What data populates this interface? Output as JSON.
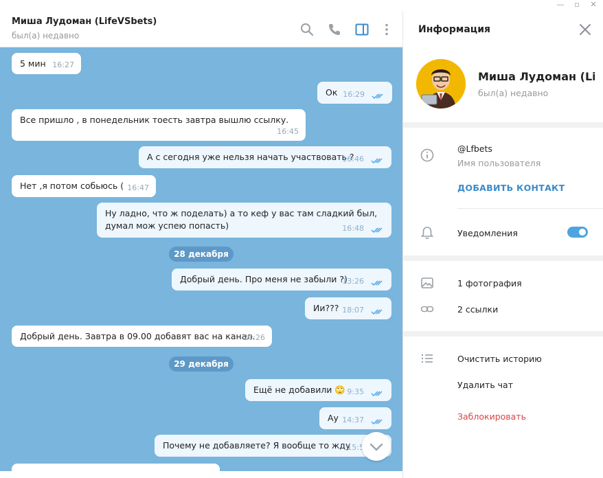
{
  "chat": {
    "title": "Миша Лудоман (LifeVSbets)",
    "status": "был(а) недавно"
  },
  "messages": [
    {
      "text": "5 мин",
      "time": "16:27",
      "out": false
    },
    {
      "text": "Ок",
      "time": "16:29",
      "out": true
    },
    {
      "text": "Все пришло , в понедельник тоесть завтра вышлю ссылку.",
      "time": "16:45",
      "out": false
    },
    {
      "text": "А с сегодня уже нельзя начать участвовать ?",
      "time": "16:46",
      "out": true
    },
    {
      "text": "Нет ,я потом собьюсь (",
      "time": "16:47",
      "out": false
    },
    {
      "text": "Ну ладно, что ж поделать) а то кеф у вас там сладкий был, думал мож успею попасть)",
      "time": "16:48",
      "out": true
    },
    {
      "text": "Добрый день. Про меня не забыли ?)",
      "time": "13:26",
      "out": true
    },
    {
      "text": "Ии???",
      "time": "18:07",
      "out": true
    },
    {
      "text": "Добрый день. Завтра в 09.00 добавят вас на канал.",
      "time": "20:26",
      "out": false
    },
    {
      "text": "Ещё не добавили 🙄",
      "time": "9:35",
      "out": true
    },
    {
      "text": "Ау",
      "time": "14:37",
      "out": true
    },
    {
      "text": "Почему не добавляете? Я вообще то жду",
      "time": "15:5",
      "out": true
    }
  ],
  "dates": [
    "28 декабря",
    "29 декабря"
  ],
  "info": {
    "title": "Информация",
    "name": "Миша Лудоман (Li…",
    "status": "был(а) недавно",
    "username": "@Lfbets",
    "username_label": "Имя пользователя",
    "add_contact": "ДОБАВИТЬ КОНТАКТ",
    "notifications": "Уведомления",
    "notifications_on": true,
    "photos": "1 фотография",
    "links": "2 ссылки",
    "clear_history": "Очистить историю",
    "delete_chat": "Удалить чат",
    "block": "Заблокировать"
  },
  "colors": {
    "chat_bg": "#79b5dc",
    "accent": "#3a8bc9",
    "danger": "#d64545"
  }
}
